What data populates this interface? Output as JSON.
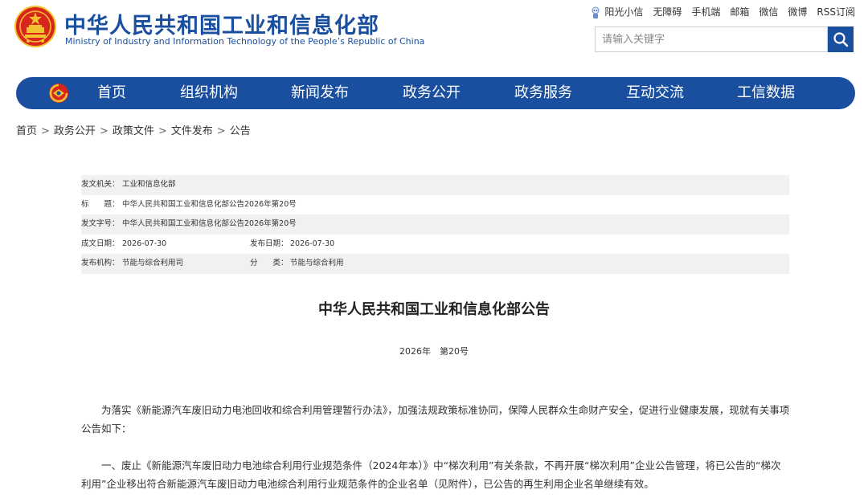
{
  "header": {
    "title": "中华人民共和国工业和信息化部",
    "subtitle": "Ministry of Industry and Information Technology of the People’s Republic of China",
    "links": [
      "阳光小信",
      "无障碍",
      "手机端",
      "邮箱",
      "微信",
      "微博",
      "RSS订阅"
    ],
    "search_placeholder": "请输入关键字"
  },
  "nav": {
    "items": [
      "首页",
      "组织机构",
      "新闻发布",
      "政务公开",
      "政务服务",
      "互动交流",
      "工信数据"
    ]
  },
  "breadcrumb": [
    "首页",
    "政务公开",
    "政策文件",
    "文件发布",
    "公告"
  ],
  "breadcrumb_sep": ">",
  "info": {
    "issuer_label": "发文机关：",
    "issuer": "工业和信息化部",
    "title_label": "标　　题：",
    "title": "中华人民共和国工业和信息化部公告2026年第20号",
    "docno_label": "发文字号：",
    "docno": "中华人民共和国工业和信息化部公告2026年第20号",
    "written_label": "成文日期：",
    "written": "2026-07-30",
    "published_label": "发布日期：",
    "published": "2026-07-30",
    "org_label": "发布机构：",
    "org": "节能与综合利用司",
    "category_label": "分　　类：",
    "category": "节能与综合利用"
  },
  "document": {
    "title": "中华人民共和国工业和信息化部公告",
    "number": "2026年　第20号",
    "paragraphs": [
      "为落实《新能源汽车废旧动力电池回收和综合利用管理暂行办法》，加强法规政策标准协同，保障人民群众生命财产安全，促进行业健康发展，现就有关事项公告如下：",
      "一、废止《新能源汽车废旧动力电池综合利用行业规范条件（2024年本）》中“梯次利用”有关条款，不再开展“梯次利用”企业公告管理，将已公告的“梯次利用”企业移出符合新能源汽车废旧动力电池综合利用行业规范条件的企业名单（见附件），已公告的再生利用企业名单继续有效。"
    ]
  },
  "colors": {
    "brand_blue": "#1a4fa0",
    "emblem_red": "#d9261c",
    "emblem_gold": "#f2c230",
    "row_shade": "#f1f1f1"
  },
  "icons": [
    "national-emblem-icon",
    "robot-icon",
    "search-icon",
    "miit-logo-icon"
  ]
}
